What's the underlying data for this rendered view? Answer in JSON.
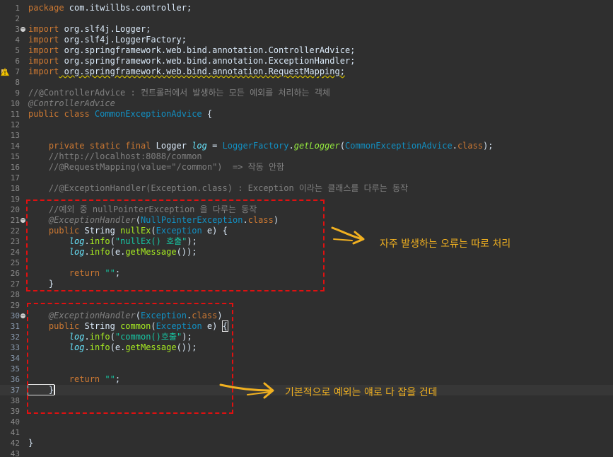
{
  "editor": {
    "lines": [
      {
        "n": "1",
        "segs": [
          [
            "kw",
            "package"
          ],
          [
            "pl",
            " com.itwillbs.controller;"
          ]
        ]
      },
      {
        "n": "2",
        "segs": []
      },
      {
        "n": "3",
        "mark": "fold",
        "segs": [
          [
            "kw",
            "import"
          ],
          [
            "pl",
            " org.slf4j.Logger;"
          ]
        ]
      },
      {
        "n": "4",
        "segs": [
          [
            "kw",
            "import"
          ],
          [
            "pl",
            " org.slf4j.LoggerFactory;"
          ]
        ]
      },
      {
        "n": "5",
        "segs": [
          [
            "kw",
            "import"
          ],
          [
            "pl",
            " org.springframework.web.bind.annotation.ControllerAdvice;"
          ]
        ]
      },
      {
        "n": "6",
        "segs": [
          [
            "kw",
            "import"
          ],
          [
            "pl",
            " org.springframework.web.bind.annotation.ExceptionHandler;"
          ]
        ]
      },
      {
        "n": "7",
        "mark": "warning",
        "segs": [
          [
            "kw",
            "import"
          ],
          [
            "pl ul",
            " org.springframework.web.bind.annotation.RequestMapping;"
          ]
        ]
      },
      {
        "n": "8",
        "segs": []
      },
      {
        "n": "9",
        "segs": [
          [
            "cm",
            "//@ControllerAdvice : 컨트롤러에서 발생하는 모든 예외를 처리하는 객체"
          ]
        ]
      },
      {
        "n": "10",
        "segs": [
          [
            "an",
            "@ControllerAdvice"
          ]
        ]
      },
      {
        "n": "11",
        "segs": [
          [
            "kw",
            "public class "
          ],
          [
            "ty",
            "CommonExceptionAdvice"
          ],
          [
            "pl",
            " {"
          ]
        ]
      },
      {
        "n": "12",
        "segs": []
      },
      {
        "n": "13",
        "segs": []
      },
      {
        "n": "14",
        "segs": [
          [
            "kw",
            "    private static final "
          ],
          [
            "pl",
            "Logger "
          ],
          [
            "fi",
            "log"
          ],
          [
            "pl",
            " = "
          ],
          [
            "ty",
            "LoggerFactory"
          ],
          [
            "pl",
            "."
          ],
          [
            "sfn",
            "getLogger"
          ],
          [
            "pl",
            "("
          ],
          [
            "ty",
            "CommonExceptionAdvice"
          ],
          [
            "pl",
            "."
          ],
          [
            "kw",
            "class"
          ],
          [
            "pl",
            ");"
          ]
        ]
      },
      {
        "n": "15",
        "segs": [
          [
            "cm",
            "    //http://localhost:8088/common"
          ]
        ]
      },
      {
        "n": "16",
        "segs": [
          [
            "cm",
            "    //@RequestMapping(value=\"/common\")  => 작동 안함"
          ]
        ]
      },
      {
        "n": "17",
        "segs": []
      },
      {
        "n": "18",
        "segs": [
          [
            "cm",
            "    //@ExceptionHandler(Exception.class) : Exception 이라는 클래스를 다루는 동작"
          ]
        ]
      },
      {
        "n": "19",
        "segs": []
      },
      {
        "n": "20",
        "segs": [
          [
            "cm",
            "    //예외 중 nullPointerException 을 다루는 동작"
          ]
        ]
      },
      {
        "n": "21",
        "mark": "fold",
        "segs": [
          [
            "an",
            "    @ExceptionHandler"
          ],
          [
            "pl",
            "("
          ],
          [
            "ty",
            "NullPointerException"
          ],
          [
            "pl",
            "."
          ],
          [
            "kw",
            "class"
          ],
          [
            "pl",
            ")"
          ]
        ]
      },
      {
        "n": "22",
        "segs": [
          [
            "kw",
            "    public "
          ],
          [
            "pl",
            "String "
          ],
          [
            "fn",
            "nullEx"
          ],
          [
            "pl",
            "("
          ],
          [
            "ty",
            "Exception"
          ],
          [
            "pl",
            " e) {"
          ]
        ]
      },
      {
        "n": "23",
        "segs": [
          [
            "fi",
            "        log"
          ],
          [
            "pl",
            "."
          ],
          [
            "fn",
            "info"
          ],
          [
            "pl",
            "("
          ],
          [
            "st",
            "\"nullEx() 호출\""
          ],
          [
            "pl",
            ");"
          ]
        ]
      },
      {
        "n": "24",
        "segs": [
          [
            "fi",
            "        log"
          ],
          [
            "pl",
            "."
          ],
          [
            "fn",
            "info"
          ],
          [
            "pl",
            "(e."
          ],
          [
            "fn",
            "getMessage"
          ],
          [
            "pl",
            "());"
          ]
        ]
      },
      {
        "n": "25",
        "segs": []
      },
      {
        "n": "26",
        "segs": [
          [
            "kw",
            "        return "
          ],
          [
            "st",
            "\"\""
          ],
          [
            "pl",
            ";"
          ]
        ]
      },
      {
        "n": "27",
        "segs": [
          [
            "pl",
            "    }"
          ]
        ]
      },
      {
        "n": "28",
        "segs": []
      },
      {
        "n": "29",
        "segs": []
      },
      {
        "n": "30",
        "mark": "fold",
        "mod": true,
        "segs": [
          [
            "an",
            "    @ExceptionHandler"
          ],
          [
            "pl",
            "("
          ],
          [
            "ty",
            "Exception"
          ],
          [
            "pl",
            "."
          ],
          [
            "kw",
            "class"
          ],
          [
            "pl",
            ")"
          ]
        ]
      },
      {
        "n": "31",
        "mod": true,
        "segs": [
          [
            "kw",
            "    public "
          ],
          [
            "pl",
            "String "
          ],
          [
            "fn",
            "common"
          ],
          [
            "pl",
            "("
          ],
          [
            "ty",
            "Exception"
          ],
          [
            "pl",
            " e) "
          ],
          [
            "pl bracket",
            "{"
          ]
        ]
      },
      {
        "n": "32",
        "mod": true,
        "segs": [
          [
            "fi",
            "        log"
          ],
          [
            "pl",
            "."
          ],
          [
            "fn",
            "info"
          ],
          [
            "pl",
            "("
          ],
          [
            "st",
            "\"common()호출\""
          ],
          [
            "pl",
            ");"
          ]
        ]
      },
      {
        "n": "33",
        "mod": true,
        "segs": [
          [
            "fi",
            "        log"
          ],
          [
            "pl",
            "."
          ],
          [
            "fn",
            "info"
          ],
          [
            "pl",
            "(e."
          ],
          [
            "fn",
            "getMessage"
          ],
          [
            "pl",
            "());"
          ]
        ]
      },
      {
        "n": "34",
        "mod": true,
        "segs": []
      },
      {
        "n": "35",
        "mod": true,
        "segs": []
      },
      {
        "n": "36",
        "mod": true,
        "segs": [
          [
            "kw",
            "        return "
          ],
          [
            "st",
            "\"\""
          ],
          [
            "pl",
            ";"
          ]
        ]
      },
      {
        "n": "37",
        "mod": true,
        "current": true,
        "segs": [
          [
            "pl bracket",
            "    }"
          ],
          [
            "pl caret",
            ""
          ]
        ]
      },
      {
        "n": "38",
        "segs": []
      },
      {
        "n": "39",
        "segs": []
      },
      {
        "n": "40",
        "segs": []
      },
      {
        "n": "41",
        "segs": []
      },
      {
        "n": "42",
        "segs": [
          [
            "pl",
            "}"
          ]
        ]
      },
      {
        "n": "43",
        "segs": []
      }
    ]
  },
  "annotations": {
    "note1": "자주 발생하는 오류는 따로 처리",
    "note2": "기본적으로 예외는 얘로 다 잡을 건데",
    "color": "#f0b020",
    "box_color": "#e01010"
  }
}
